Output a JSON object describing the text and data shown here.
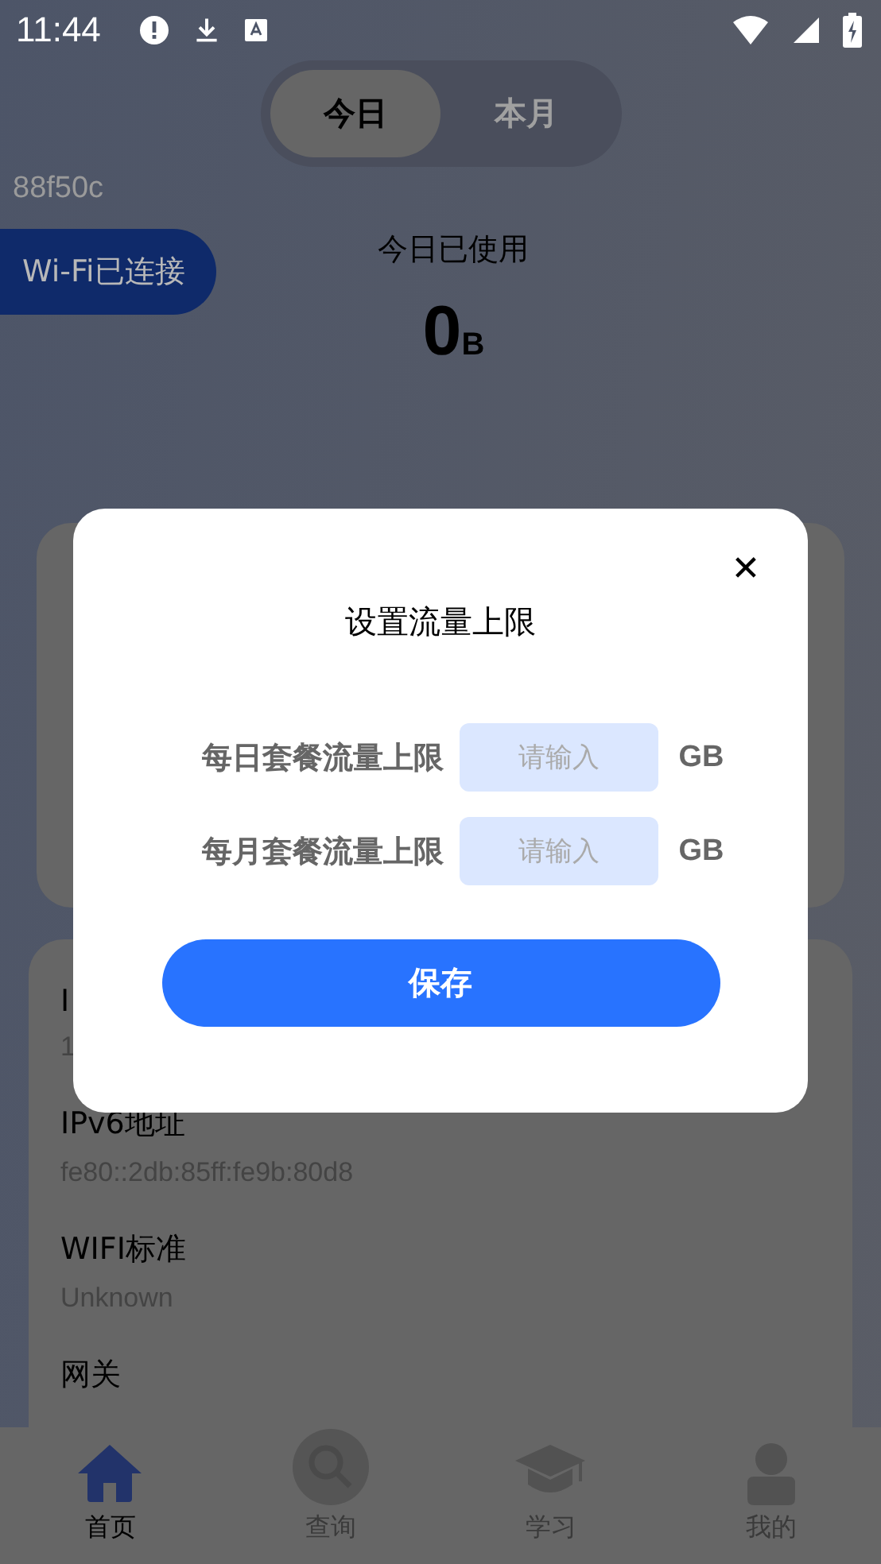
{
  "status_bar": {
    "time": "11:44"
  },
  "period_tabs": [
    {
      "label": "今日",
      "selected": true
    },
    {
      "label": "本月",
      "selected": false
    }
  ],
  "device_id": "88f50c",
  "connection_badge": "Wi-Fi已连接",
  "usage": {
    "title": "今日已使用",
    "value": "0",
    "unit": "B"
  },
  "info_list": [
    {
      "label": "I",
      "value": "1"
    },
    {
      "label": "IPv6地址",
      "value": "fe80::2db:85ff:fe9b:80d8"
    },
    {
      "label": "WIFI标准",
      "value": "Unknown"
    },
    {
      "label": "网关"
    }
  ],
  "bottom_nav": [
    {
      "label": "首页",
      "selected": true
    },
    {
      "label": "查询",
      "selected": false
    },
    {
      "label": "学习",
      "selected": false
    },
    {
      "label": "我的",
      "selected": false
    }
  ],
  "dialog": {
    "title": "设置流量上限",
    "close": "✕",
    "fields": [
      {
        "label": "每日套餐流量上限",
        "placeholder": "请输入",
        "unit": "GB"
      },
      {
        "label": "每月套餐流量上限",
        "placeholder": "请输入",
        "unit": "GB"
      }
    ],
    "save_button": "保存"
  }
}
